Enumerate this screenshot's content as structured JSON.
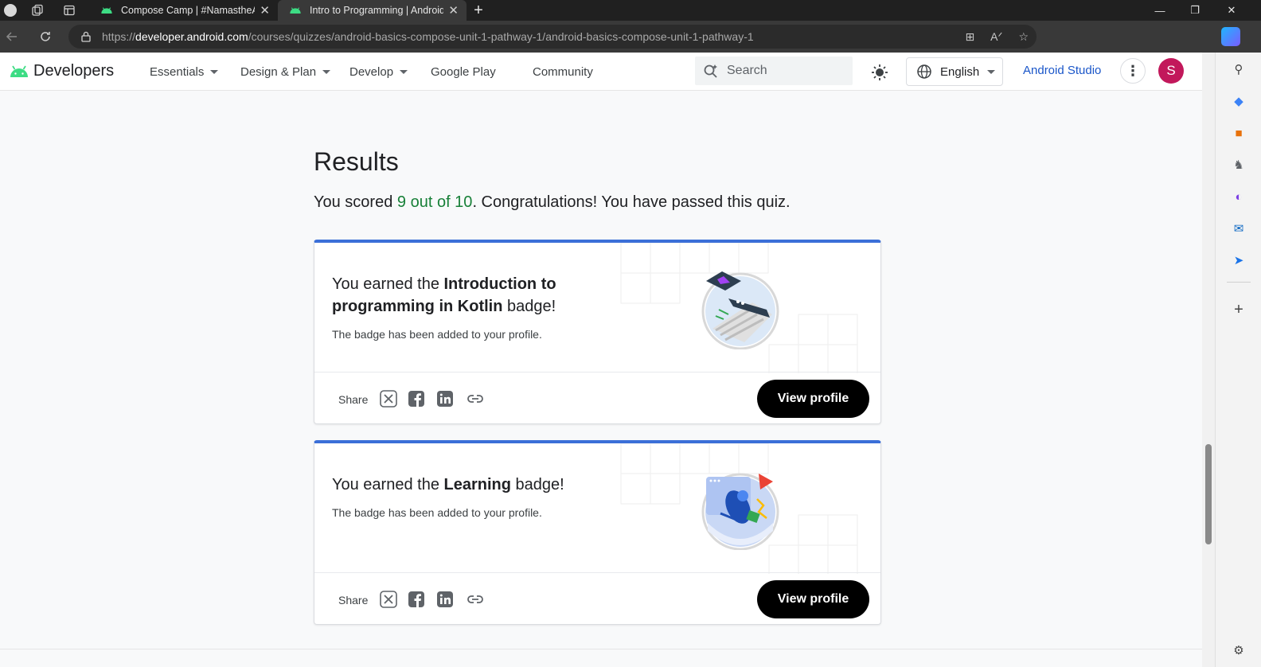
{
  "browser": {
    "tabs": [
      {
        "title": "Compose Camp | #NamastheAndroid"
      },
      {
        "title": "Intro to Programming  |  Android Developers"
      }
    ],
    "url_prefix": "https://",
    "url_host": "developer.android.com",
    "url_path": "/courses/quizzes/android-basics-compose-unit-1-pathway-1/android-basics-compose-unit-1-pathway-1"
  },
  "site": {
    "logo_text": "Developers",
    "nav": [
      {
        "label": "Essentials"
      },
      {
        "label": "Design & Plan"
      },
      {
        "label": "Develop"
      },
      {
        "label": "Google Play"
      },
      {
        "label": "Community"
      }
    ],
    "search_placeholder": "Search",
    "language": "English",
    "studio_link": "Android Studio",
    "user_initial": "S"
  },
  "results": {
    "title": "Results",
    "score_prefix": "You scored ",
    "score_value": "9 out of 10",
    "score_suffix": ". Congratulations! You have passed this quiz."
  },
  "cards": [
    {
      "earned_prefix": "You earned the ",
      "badge_name": "Introduction to programming in Kotlin",
      "earned_suffix": " badge!",
      "sub": "The badge has been added to your profile.",
      "share_label": "Share",
      "button": "View profile"
    },
    {
      "earned_prefix": "You earned the ",
      "badge_name": "Learning",
      "earned_suffix": " badge!",
      "sub": "The badge has been added to your profile.",
      "share_label": "Share",
      "button": "View profile"
    }
  ],
  "colors": {
    "accent_blue": "#3b6fd8",
    "score_green": "#188038",
    "link_blue": "#1a56c9",
    "android_green": "#3ddc84"
  }
}
